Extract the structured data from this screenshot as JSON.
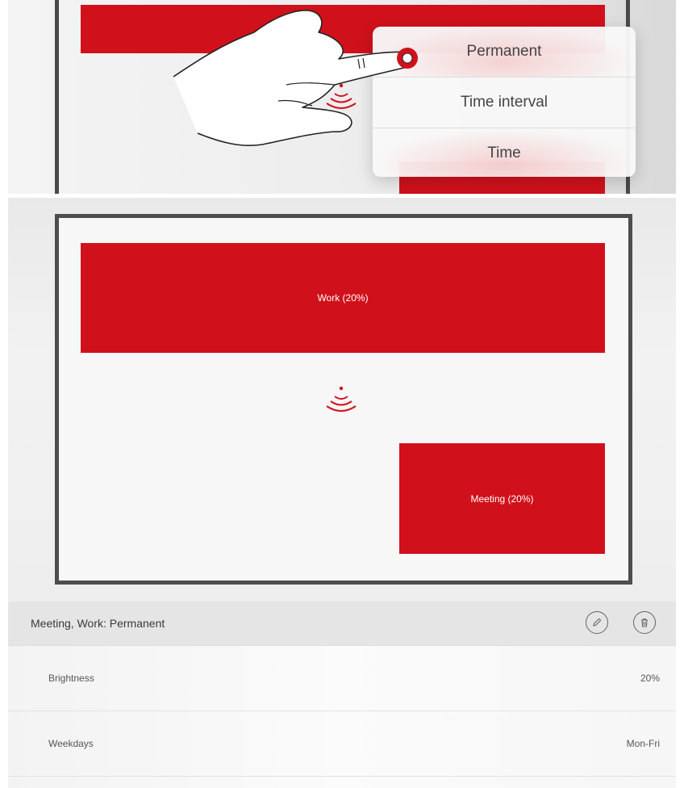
{
  "popup": {
    "options": [
      "Permanent",
      "Time interval",
      "Time"
    ]
  },
  "zones": {
    "work_label": "Work (20%)",
    "meeting_label": "Meeting (20%)"
  },
  "summary": {
    "title": "Meeting, Work: Permanent"
  },
  "details": {
    "brightness_label": "Brightness",
    "brightness_value": "20%",
    "weekdays_label": "Weekdays",
    "weekdays_value": "Mon-Fri"
  },
  "colors": {
    "accent_red": "#d0111b",
    "frame": "#4d4d4d"
  },
  "icons": [
    "hand-pointer-icon",
    "sensor-icon",
    "edit-pencil-icon",
    "trash-icon"
  ]
}
